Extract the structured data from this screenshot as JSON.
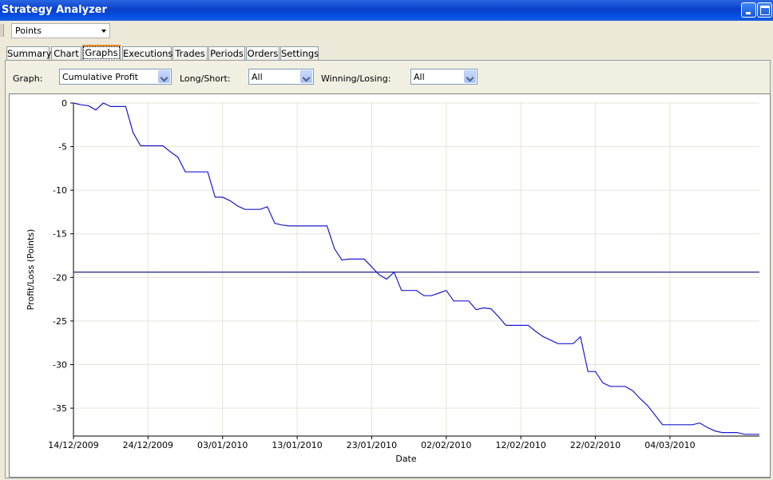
{
  "window": {
    "title": "Strategy Analyzer"
  },
  "toolbar": {
    "unit_selector": "Points"
  },
  "tabs": [
    {
      "label": "Summary",
      "active": false
    },
    {
      "label": "Chart",
      "active": false
    },
    {
      "label": "Graphs",
      "active": true
    },
    {
      "label": "Executions",
      "active": false
    },
    {
      "label": "Trades",
      "active": false
    },
    {
      "label": "Periods",
      "active": false
    },
    {
      "label": "Orders",
      "active": false
    },
    {
      "label": "Settings",
      "active": false
    }
  ],
  "filters": {
    "graph_label": "Graph:",
    "graph_value": "Cumulative Profit",
    "longshort_label": "Long/Short:",
    "longshort_value": "All",
    "winlose_label": "Winning/Losing:",
    "winlose_value": "All"
  },
  "colors": {
    "line": "#1a1acf",
    "average_line": "#1b1b80",
    "grid": "#e6e3d6"
  },
  "chart_data": {
    "type": "line",
    "xlabel": "Date",
    "ylabel": "Profit/Loss (Points)",
    "ylim": [
      -38.2,
      0
    ],
    "yticks": [
      0,
      -5,
      -10,
      -15,
      -20,
      -25,
      -30,
      -35
    ],
    "xticks": [
      "14/12/2009",
      "24/12/2009",
      "03/01/2010",
      "13/01/2010",
      "23/01/2010",
      "02/02/2010",
      "12/02/2010",
      "22/02/2010",
      "04/03/2010"
    ],
    "x_start": "2009-12-14",
    "x_end": "2010-03-16",
    "reference_line": -19.4,
    "series": [
      {
        "x": [
          "2009-12-14",
          "2009-12-15",
          "2009-12-16",
          "2009-12-17",
          "2009-12-17",
          "2009-12-18",
          "2009-12-19",
          "2009-12-20",
          "2009-12-21",
          "2009-12-22",
          "2009-12-23",
          "2009-12-24",
          "2009-12-25",
          "2009-12-26",
          "2009-12-27",
          "2009-12-28",
          "2009-12-29",
          "2009-12-30",
          "2009-12-31",
          "2010-01-01",
          "2010-01-02",
          "2010-01-03",
          "2010-01-04",
          "2010-01-05",
          "2010-01-06",
          "2010-01-07",
          "2010-01-08",
          "2010-01-09",
          "2010-01-10",
          "2010-01-11",
          "2010-01-12",
          "2010-01-13",
          "2010-01-14",
          "2010-01-15",
          "2010-01-16",
          "2010-01-17",
          "2010-01-18",
          "2010-01-19",
          "2010-01-20",
          "2010-01-21",
          "2010-01-22",
          "2010-01-23",
          "2010-01-24",
          "2010-01-25",
          "2010-01-26",
          "2010-01-27",
          "2010-01-28",
          "2010-01-29",
          "2010-01-30",
          "2010-01-31",
          "2010-02-01",
          "2010-02-02",
          "2010-02-03",
          "2010-02-04",
          "2010-02-05",
          "2010-02-06",
          "2010-02-07",
          "2010-02-08",
          "2010-02-09",
          "2010-02-10",
          "2010-02-11",
          "2010-02-12",
          "2010-02-13",
          "2010-02-14",
          "2010-02-15",
          "2010-02-16",
          "2010-02-17",
          "2010-02-18",
          "2010-02-19",
          "2010-02-20",
          "2010-02-21",
          "2010-02-22",
          "2010-02-23",
          "2010-02-24",
          "2010-02-25",
          "2010-02-26",
          "2010-02-27",
          "2010-02-28",
          "2010-03-01",
          "2010-03-02",
          "2010-03-03",
          "2010-03-04",
          "2010-03-05",
          "2010-03-06",
          "2010-03-07",
          "2010-03-08",
          "2010-03-09",
          "2010-03-10",
          "2010-03-11",
          "2010-03-12",
          "2010-03-13",
          "2010-03-14",
          "2010-03-15",
          "2010-03-16"
        ],
        "y": [
          0,
          -0.2,
          -0.3,
          -0.8,
          -0.8,
          0,
          -0.4,
          -0.4,
          -0.4,
          -3.4,
          -4.9,
          -4.9,
          -4.9,
          -4.9,
          -5.6,
          -6.2,
          -7.9,
          -7.9,
          -7.9,
          -7.9,
          -10.8,
          -10.8,
          -11.2,
          -11.8,
          -12.2,
          -12.2,
          -12.2,
          -11.9,
          -13.8,
          -14.0,
          -14.1,
          -14.1,
          -14.1,
          -14.1,
          -14.1,
          -14.1,
          -16.7,
          -18.0,
          -17.9,
          -17.9,
          -17.9,
          -18.8,
          -19.7,
          -20.2,
          -19.4,
          -21.5,
          -21.5,
          -21.5,
          -22.1,
          -22.1,
          -21.8,
          -21.5,
          -22.7,
          -22.7,
          -22.7,
          -23.7,
          -23.5,
          -23.6,
          -24.5,
          -25.5,
          -25.5,
          -25.5,
          -25.5,
          -26.2,
          -26.8,
          -27.2,
          -27.6,
          -27.6,
          -27.6,
          -26.8,
          -30.8,
          -30.8,
          -32.1,
          -32.5,
          -32.5,
          -32.5,
          -33.0,
          -33.9,
          -34.7,
          -35.8,
          -36.9,
          -36.9,
          -36.9,
          -36.9,
          -36.9,
          -36.7,
          -37.2,
          -37.6,
          -37.8,
          -37.8,
          -37.8,
          -38.0,
          -38.0,
          -38.0
        ]
      }
    ]
  }
}
